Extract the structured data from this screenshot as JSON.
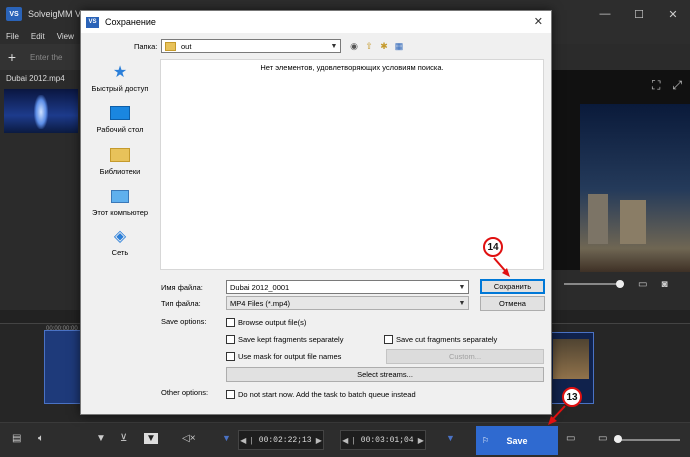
{
  "app": {
    "title": "SolveigMM Vid",
    "logo": "VS",
    "min": "—",
    "max": "☐",
    "close": "✕",
    "menu": [
      "File",
      "Edit",
      "View"
    ],
    "add_label": "+",
    "enter_placeholder": "Enter the",
    "media_file": "Dubai 2012.mp4",
    "timeline_time": "00:00:00;00"
  },
  "dialog": {
    "title": "Сохранение",
    "logo": "VS",
    "close": "✕",
    "folder_label": "Папка:",
    "folder_value": "out",
    "places": [
      {
        "label": "Быстрый доступ",
        "icon": "star-icon"
      },
      {
        "label": "Рабочий стол",
        "icon": "desktop-icon"
      },
      {
        "label": "Библиотеки",
        "icon": "libraries-icon"
      },
      {
        "label": "Этот компьютер",
        "icon": "computer-icon"
      },
      {
        "label": "Сеть",
        "icon": "network-icon"
      }
    ],
    "empty_message": "Нет элементов, удовлетворяющих условиям поиска.",
    "filename_label": "Имя файла:",
    "filename_value": "Dubai 2012_0001",
    "filetype_label": "Тип файла:",
    "filetype_value": "MP4 Files (*.mp4)",
    "save_button": "Сохранить",
    "cancel_button": "Отмена",
    "save_options_label": "Save options:",
    "opt_browse": "Browse output file(s)",
    "opt_kept": "Save kept fragments separately",
    "opt_cut": "Save cut fragments separately",
    "opt_mask": "Use mask for output file names",
    "custom_button": "Custom...",
    "streams_button": "Select streams...",
    "other_options_label": "Other options:",
    "opt_batch": "Do not start now. Add the task to batch queue instead"
  },
  "bottom": {
    "time_start": "00:02:22;13",
    "time_end": "00:03:01;04",
    "save_label": "Save"
  },
  "callouts": {
    "c14": "14",
    "c13": "13"
  },
  "colors": {
    "accent": "#2f6ad0",
    "callout_border": "#e01010"
  }
}
